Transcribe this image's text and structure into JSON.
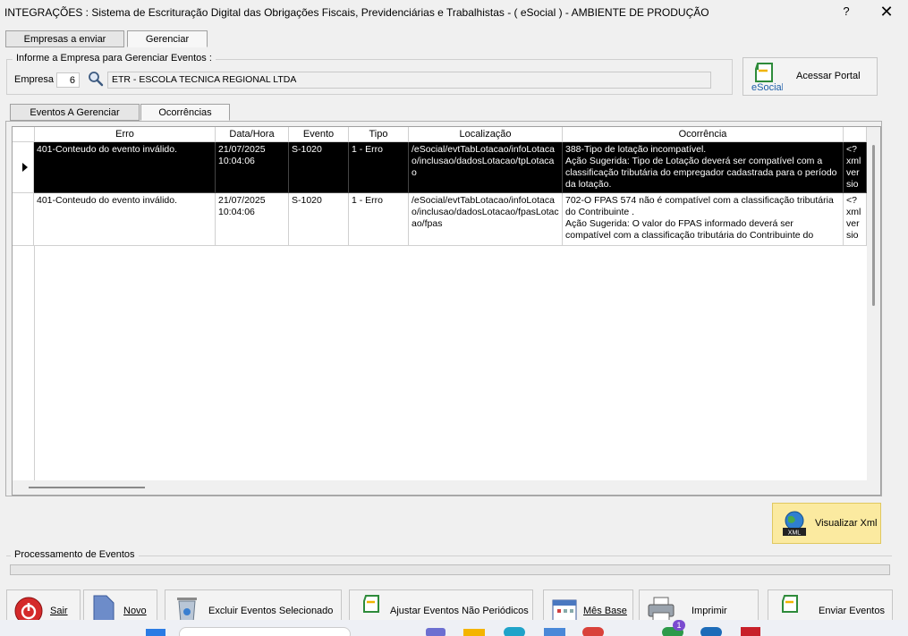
{
  "window": {
    "title": "INTEGRAÇÕES : Sistema de Escrituração Digital das Obrigações Fiscais, Previdenciárias e Trabalhistas - ( eSocial ) - AMBIENTE DE PRODUÇÃO",
    "help": "?",
    "close": "✕"
  },
  "main_tabs": [
    "Empresas a enviar",
    "Gerenciar"
  ],
  "empresa_group": {
    "legend": "Informe a Empresa para Gerenciar Eventos :",
    "label": "Empresa",
    "code": "6",
    "name": "ETR - ESCOLA TECNICA REGIONAL LTDA"
  },
  "portal_button": {
    "label": "Acessar Portal",
    "logo_text": "eSocial"
  },
  "sub_tabs": [
    "Eventos A Gerenciar",
    "Ocorrências"
  ],
  "grid": {
    "columns": [
      "Erro",
      "Data/Hora",
      "Evento",
      "Tipo",
      "Localização",
      "Ocorrência",
      ""
    ],
    "rows": [
      {
        "erro": "401-Conteudo do evento inválido.",
        "datahora": "21/07/2025\n10:04:06",
        "evento": "S-1020",
        "tipo": "1 - Erro",
        "localizacao": "/eSocial/evtTabLotacao/infoLotacao/inclusao/dadosLotacao/tpLotacao",
        "ocorrencia": "388-Tipo de lotação incompatível.\nAção Sugerida: Tipo de Lotação deverá ser compatível com a classificação tributária do empregador cadastrada para o período da lotação.",
        "xml": "<?\nxml\nver\nsio"
      },
      {
        "erro": "401-Conteudo do evento inválido.",
        "datahora": "21/07/2025\n10:04:06",
        "evento": "S-1020",
        "tipo": "1 - Erro",
        "localizacao": "/eSocial/evtTabLotacao/infoLotacao/inclusao/dadosLotacao/fpasLotacao/fpas",
        "ocorrencia": "702-O FPAS 574 não é compatível com a classificação tributária do Contribuinte .\nAção Sugerida: O valor do FPAS informado deverá ser compatível com a classificação tributária do Contribuinte do",
        "xml": "<?\nxml\nver\nsio"
      }
    ]
  },
  "xml_button": {
    "label": "Visualizar Xml",
    "icon_text": "XML"
  },
  "processing": {
    "legend": "Processamento de Eventos",
    "progress": 0
  },
  "bottom_buttons": {
    "sair": "Sair",
    "novo": "Novo",
    "excluir": "Excluir Eventos Selecionado",
    "ajustar": "Ajustar Eventos Não Periódicos",
    "mes_base": "Mês Base",
    "imprimir": "Imprimir",
    "enviar": "Enviar Eventos"
  },
  "taskbar": {
    "badge": "1"
  }
}
